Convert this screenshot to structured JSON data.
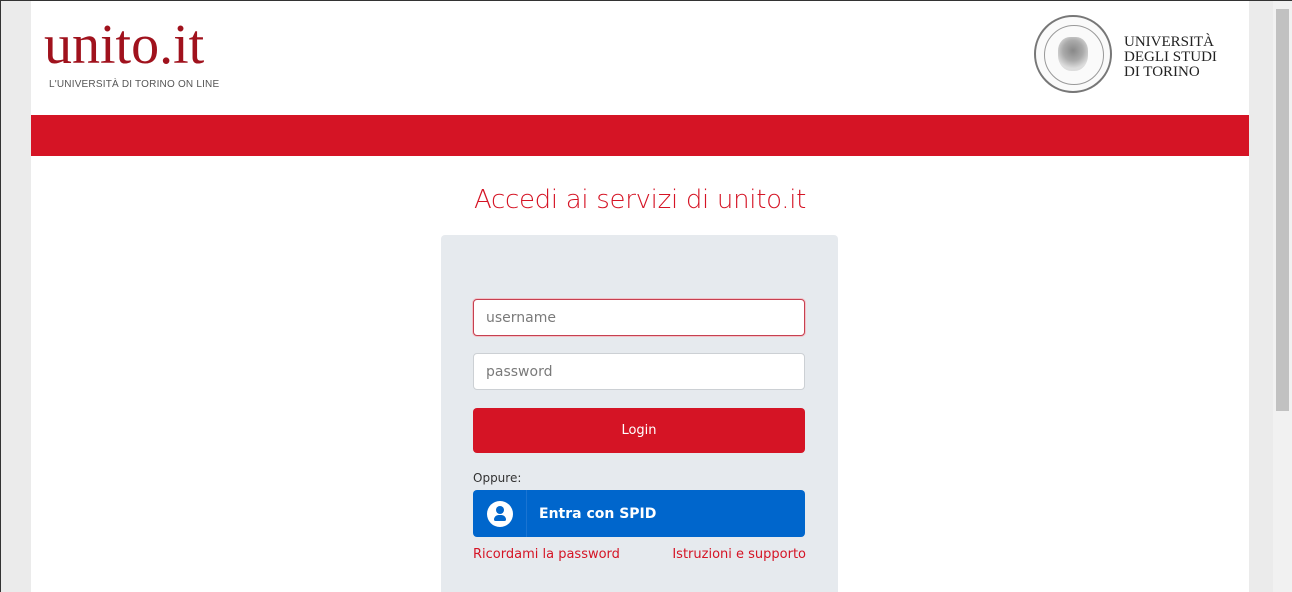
{
  "header": {
    "logo_text": "unito.it",
    "logo_tagline": "L'UNIVERSITÀ DI TORINO ON LINE",
    "university_name": [
      "UNIVERSITÀ",
      "DEGLI STUDI",
      "DI TORINO"
    ]
  },
  "login": {
    "title": "Accedi ai servizi di unito.it",
    "username_placeholder": "username",
    "username_value": "",
    "password_placeholder": "password",
    "password_value": "",
    "login_label": "Login",
    "or_label": "Oppure:",
    "spid_label": "Entra con SPID",
    "remember_password_link": "Ricordami la password",
    "help_link": "Istruzioni e supporto"
  },
  "colors": {
    "brand_red": "#d51425",
    "spid_blue": "#0066cc",
    "logo_red": "#a0121d"
  },
  "icons": {
    "spid": "user-circle-icon",
    "seal": "university-seal"
  }
}
